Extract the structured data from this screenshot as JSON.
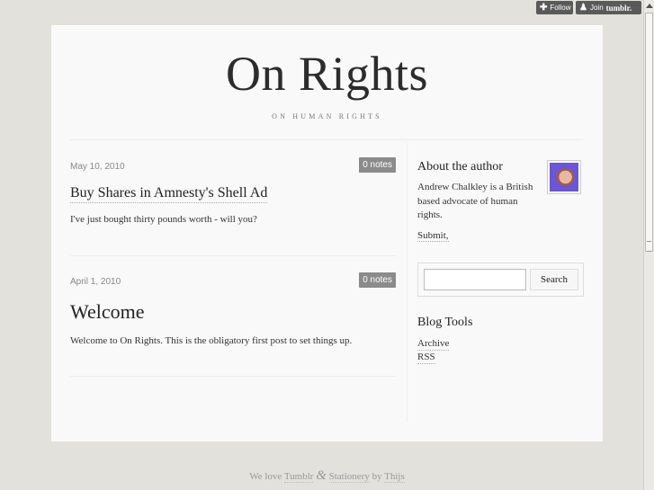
{
  "tumblr": {
    "follow_label": "Follow",
    "join_label": "Join",
    "brand": "tumblr."
  },
  "site": {
    "title": "On Rights",
    "subtitle": "On Human Rights"
  },
  "posts": [
    {
      "date": "May 10, 2010",
      "notes": "0 notes",
      "title": "Buy Shares in Amnesty's Shell Ad",
      "body": "I've just bought thirty pounds worth - will you?"
    },
    {
      "date": "April 1, 2010",
      "notes": "0 notes",
      "title": "Welcome",
      "body": "Welcome to On Rights. This is the obligatory first post to set things up."
    }
  ],
  "sidebar": {
    "about_heading": "About the author",
    "bio": "Andrew Chalkley is a British based advocate of human rights.",
    "submit_label": "Submit,",
    "search_value": "",
    "search_button": "Search",
    "tools_heading": "Blog Tools",
    "tools": [
      "Archive",
      "RSS"
    ]
  },
  "footer": {
    "love_prefix": "We love",
    "tumblr_link": "Tumblr",
    "amp": "&",
    "stationery_link": "Stationery",
    "by_text": "by",
    "author_link": "Thijs"
  }
}
